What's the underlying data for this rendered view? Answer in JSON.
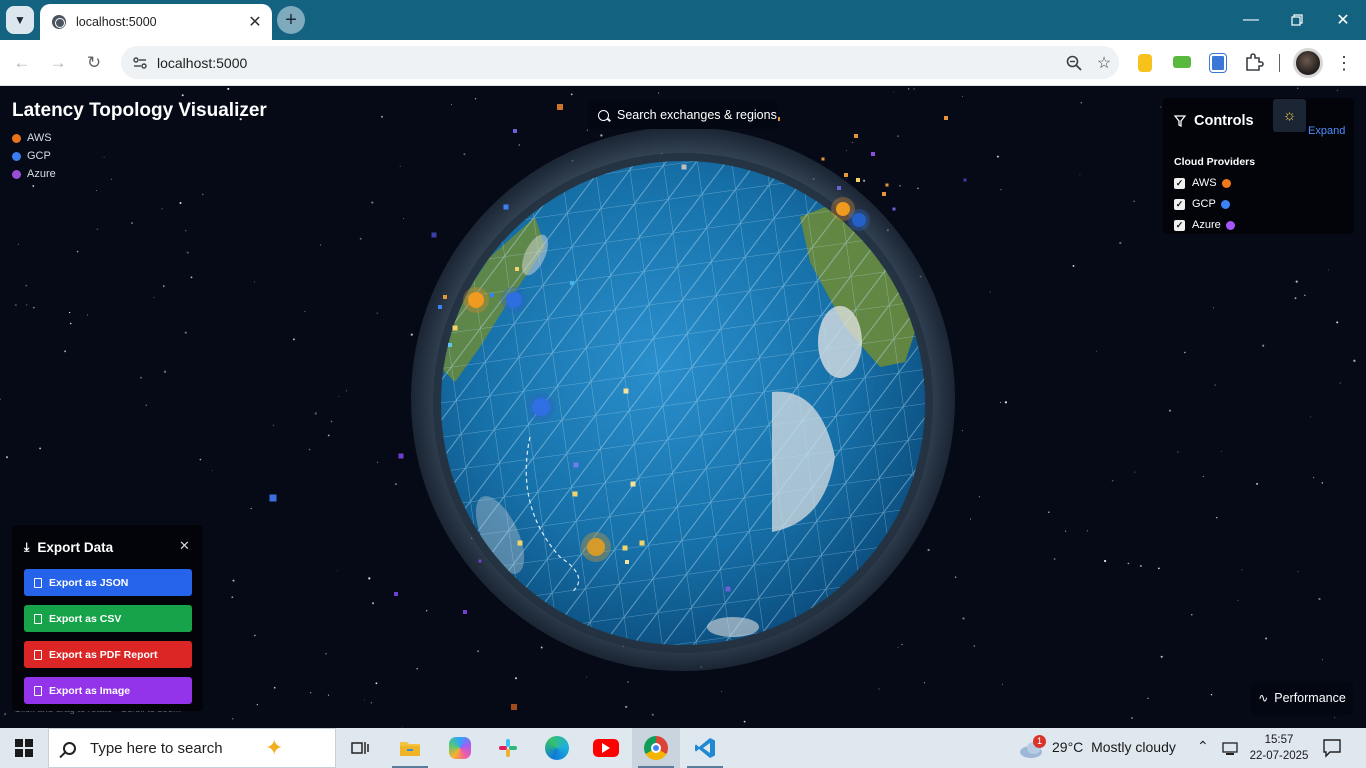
{
  "browser": {
    "tab_title": "localhost:5000",
    "url": "localhost:5000"
  },
  "app": {
    "title": "Latency Topology Visualizer",
    "legend": [
      {
        "label": "AWS",
        "color": "#e8731c"
      },
      {
        "label": "GCP",
        "color": "#3b7cf0"
      },
      {
        "label": "Azure",
        "color": "#9b4fd9"
      }
    ],
    "search_label": "Search exchanges & regions",
    "controls": {
      "title": "Controls",
      "expand_label": "Expand",
      "providers_heading": "Cloud Providers",
      "providers": [
        {
          "label": "AWS",
          "checked": true,
          "color": "#f07a1a"
        },
        {
          "label": "GCP",
          "checked": true,
          "color": "#3b82f6"
        },
        {
          "label": "Azure",
          "checked": true,
          "color": "#a855f7"
        }
      ]
    },
    "export": {
      "title": "Export Data",
      "buttons": [
        {
          "label": "Export as JSON",
          "color": "#2563eb"
        },
        {
          "label": "Export as CSV",
          "color": "#16a34a"
        },
        {
          "label": "Export as PDF Report",
          "color": "#dc2626"
        },
        {
          "label": "Export as Image",
          "color": "#9333ea"
        }
      ]
    },
    "hint_text": "Click and drag to rotate • Scroll to zoom",
    "performance_label": "Performance"
  },
  "taskbar": {
    "search_placeholder": "Type here to search",
    "weather_temp": "29°C",
    "weather_desc": "Mostly cloudy",
    "weather_badge": "1",
    "time": "15:57",
    "date": "22-07-2025"
  }
}
